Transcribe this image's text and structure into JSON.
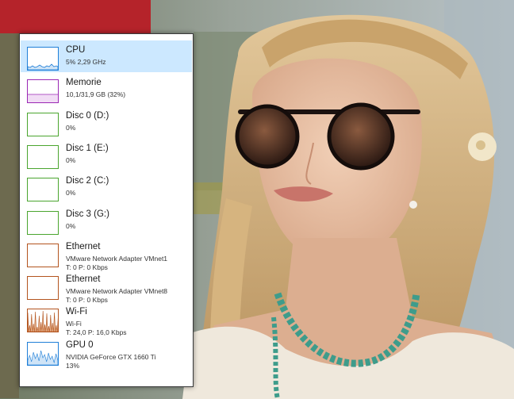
{
  "colors": {
    "cpu": "#1f7fd8",
    "memory": "#9b28b4",
    "disk": "#4aa52e",
    "network": "#b3541e",
    "gpu": "#1f7fd8",
    "selected": "#cce8ff"
  },
  "performance_list": [
    {
      "name": "CPU",
      "line1": "5% 2,29 GHz",
      "line2": "",
      "graph": "cpu",
      "selected": true
    },
    {
      "name": "Memorie",
      "line1": "10,1/31,9 GB (32%)",
      "line2": "",
      "graph": "memory",
      "selected": false
    },
    {
      "name": "Disc 0 (D:)",
      "line1": "0%",
      "line2": "",
      "graph": "disk",
      "selected": false
    },
    {
      "name": "Disc 1 (E:)",
      "line1": "0%",
      "line2": "",
      "graph": "disk",
      "selected": false
    },
    {
      "name": "Disc 2 (C:)",
      "line1": "0%",
      "line2": "",
      "graph": "disk",
      "selected": false
    },
    {
      "name": "Disc 3 (G:)",
      "line1": "0%",
      "line2": "",
      "graph": "disk",
      "selected": false
    },
    {
      "name": "Ethernet",
      "line1": "VMware Network Adapter VMnet1",
      "line2": "T: 0 P: 0 Kbps",
      "graph": "network",
      "selected": false
    },
    {
      "name": "Ethernet",
      "line1": "VMware Network Adapter VMnet8",
      "line2": "T: 0 P: 0 Kbps",
      "graph": "network",
      "selected": false
    },
    {
      "name": "Wi-Fi",
      "line1": "Wi-Fi",
      "line2": "T: 24,0 P: 16,0 Kbps",
      "graph": "wifi",
      "selected": false
    },
    {
      "name": "GPU 0",
      "line1": "NVIDIA GeForce GTX 1660 Ti",
      "line2": "13%",
      "graph": "gpu",
      "selected": false
    }
  ]
}
